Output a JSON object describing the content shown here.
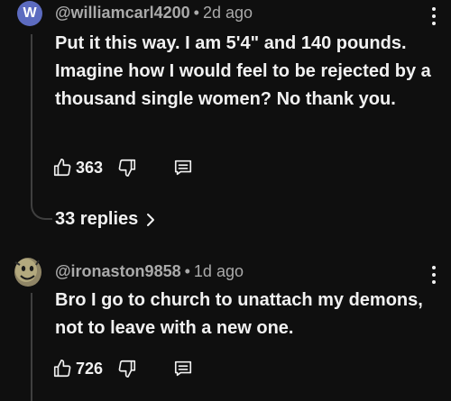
{
  "comments": [
    {
      "avatar_letter": "W",
      "avatar_color": "#5c6bc0",
      "handle": "@williamcarl4200",
      "age": "2d ago",
      "text": "Put it this way. I am 5'4\" and 140 pounds. Imagine how I would feel to be rejected by a thousand single women? No thank you.",
      "likes": "363",
      "replies_label": "33 replies"
    },
    {
      "avatar_icon": "smiley-rock-avatar",
      "handle": "@ironaston9858",
      "age": "1d ago",
      "text": "Bro I go to church to unattach my demons, not to leave with a new one.",
      "likes": "726"
    }
  ],
  "icons": {
    "like": "thumbs-up-icon",
    "dislike": "thumbs-down-icon",
    "reply": "reply-icon",
    "more": "more-vert-icon",
    "chevron": "chevron-right-icon"
  },
  "colors": {
    "background": "#0f0f0f",
    "text_primary": "#f1f1f1",
    "text_secondary": "#aaaaaa",
    "thread_line": "#3f3f3f"
  }
}
